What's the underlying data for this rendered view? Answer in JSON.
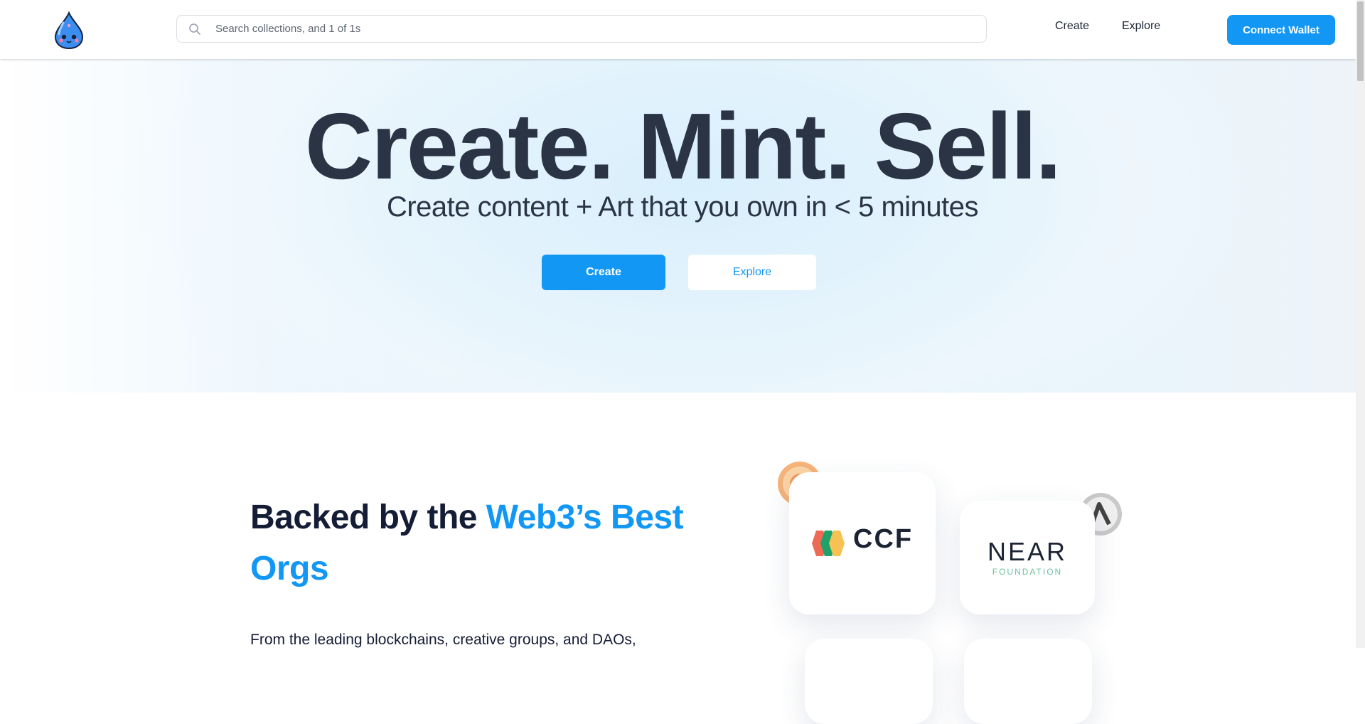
{
  "header": {
    "search_placeholder": "Search collections, and 1 of 1s",
    "nav": {
      "create": "Create",
      "explore": "Explore"
    },
    "connect_wallet": "Connect Wallet"
  },
  "hero": {
    "title": "Create. Mint. Sell.",
    "subtitle": "Create content + Art that you own in < 5 minutes",
    "create_button": "Create",
    "explore_button": "Explore"
  },
  "backed": {
    "title_plain": "Backed by the ",
    "title_accent": "Web3’s Best Orgs",
    "text": "From the leading blockchains, creative groups, and DAOs,",
    "logos": [
      {
        "name": "CCF",
        "text": "CCF"
      },
      {
        "name": "NEAR Foundation",
        "text": "NEAR",
        "subtext": "FOUNDATION"
      }
    ]
  },
  "colors": {
    "accent": "#1297f5",
    "title": "#2b3445",
    "dark": "#151d36",
    "near_green": "#6cc3a0"
  }
}
